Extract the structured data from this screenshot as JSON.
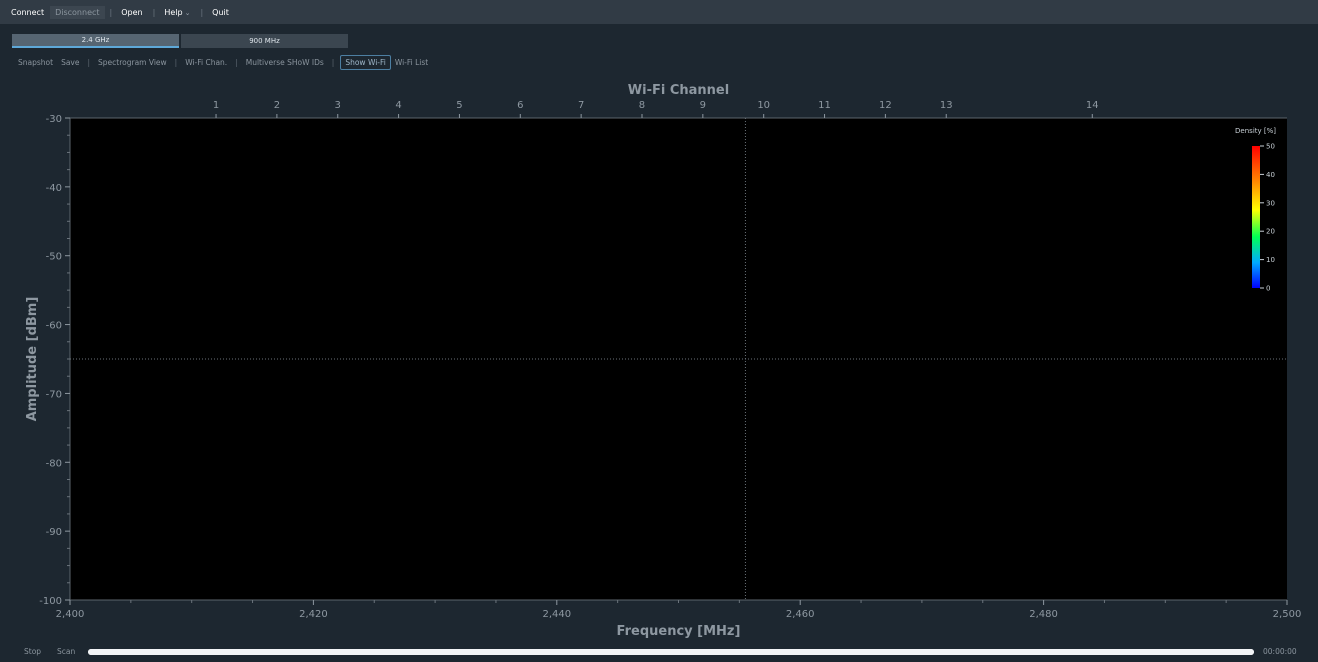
{
  "menu": {
    "items": [
      {
        "label": "Connect",
        "enabled": true
      },
      {
        "label": "Disconnect",
        "enabled": false
      },
      {
        "label": "Open",
        "enabled": true
      },
      {
        "label": "Help",
        "enabled": true,
        "dropdown": true
      },
      {
        "label": "Quit",
        "enabled": true
      }
    ]
  },
  "bands": {
    "tabs": [
      {
        "label": "2.4 GHz",
        "selected": true
      },
      {
        "label": "900 MHz",
        "selected": false
      }
    ]
  },
  "toolbar": {
    "snapshot": "Snapshot",
    "save": "Save",
    "spectrogram_view": "Spectrogram View",
    "wifi_chan": "Wi-Fi Chan.",
    "multiverse": "Multiverse SHoW IDs",
    "show_wifi": "Show Wi-Fi",
    "wifi_list": "Wi-Fi List"
  },
  "colors": {
    "background": "#1d2730",
    "plot_background": "#000000",
    "axis_text": "#8e98a1",
    "accent": "#5ea8d8"
  },
  "chart_data": {
    "type": "line",
    "title": "",
    "top_axis_label": "Wi-Fi Channel",
    "xlabel": "Frequency [MHz]",
    "ylabel": "Amplitude [dBm]",
    "xlim": [
      2400,
      2500
    ],
    "ylim": [
      -100,
      -30
    ],
    "x_ticks": [
      2400,
      2420,
      2440,
      2460,
      2480,
      2500
    ],
    "x_tick_labels": [
      "2,400",
      "2,420",
      "2,440",
      "2,460",
      "2,480",
      "2,500"
    ],
    "y_ticks": [
      -30,
      -40,
      -50,
      -60,
      -70,
      -80,
      -90,
      -100
    ],
    "y_tick_labels": [
      "-30",
      "-40",
      "-50",
      "-60",
      "-70",
      "-80",
      "-90",
      "-100"
    ],
    "wifi_channels": [
      {
        "label": "1",
        "freq": 2412
      },
      {
        "label": "2",
        "freq": 2417
      },
      {
        "label": "3",
        "freq": 2422
      },
      {
        "label": "4",
        "freq": 2427
      },
      {
        "label": "5",
        "freq": 2432
      },
      {
        "label": "6",
        "freq": 2437
      },
      {
        "label": "7",
        "freq": 2442
      },
      {
        "label": "8",
        "freq": 2447
      },
      {
        "label": "9",
        "freq": 2452
      },
      {
        "label": "10",
        "freq": 2457
      },
      {
        "label": "11",
        "freq": 2462
      },
      {
        "label": "12",
        "freq": 2467
      },
      {
        "label": "13",
        "freq": 2472
      },
      {
        "label": "14",
        "freq": 2484
      }
    ],
    "cursor": {
      "x": 2455.5,
      "y": -65
    },
    "series": [],
    "grid": false,
    "colorbar": {
      "label": "Density [%]",
      "ticks": [
        0,
        10,
        20,
        30,
        40,
        50
      ],
      "tick_labels": [
        "0",
        "10",
        "20",
        "30",
        "40",
        "50"
      ],
      "position": "top-right"
    }
  },
  "status": {
    "stop": "Stop",
    "scan": "Scan",
    "progress": 1.0,
    "elapsed": "00:00:00"
  }
}
